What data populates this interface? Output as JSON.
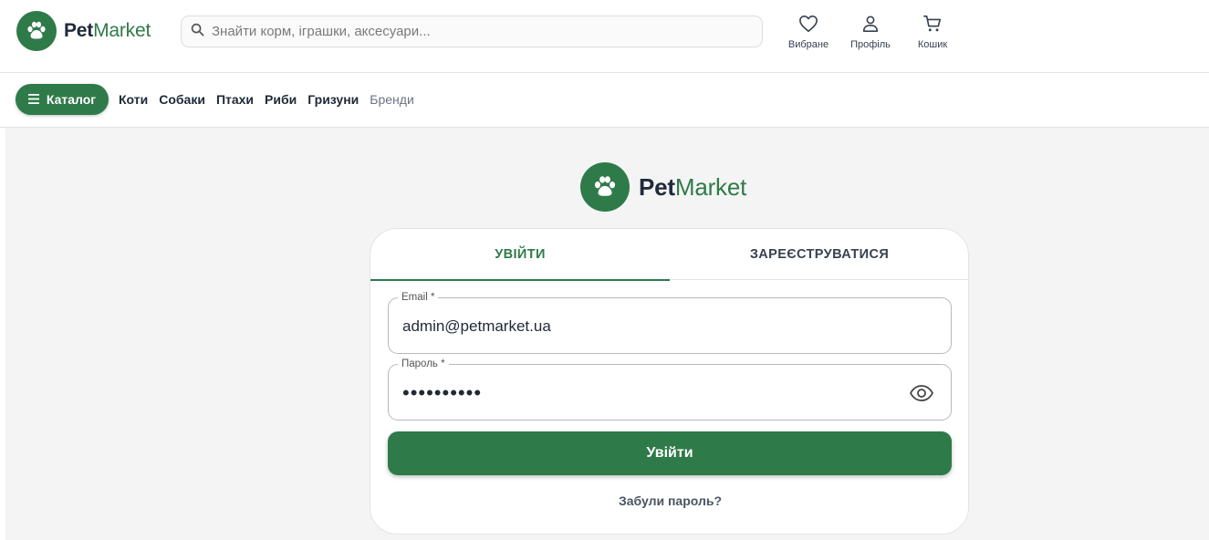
{
  "colors": {
    "brand": "#2f7a49",
    "brand_dark": "#1f2a3a",
    "accent_text": "#2f7a49"
  },
  "brand": {
    "part1": "Pet",
    "part2": "Market"
  },
  "search": {
    "placeholder": "Знайти корм, іграшки, аксесуари..."
  },
  "header_actions": [
    {
      "icon": "heart-icon",
      "label": "Вибране"
    },
    {
      "icon": "user-icon",
      "label": "Профіль"
    },
    {
      "icon": "cart-icon",
      "label": "Кошик"
    }
  ],
  "nav": {
    "catalog_label": "Каталог",
    "links": [
      "Коти",
      "Собаки",
      "Птахи",
      "Риби",
      "Гризуни",
      "Бренди"
    ]
  },
  "auth": {
    "tabs": {
      "login": "УВІЙТИ",
      "register": "ЗАРЕЄСТРУВАТИСЯ",
      "active": "login"
    },
    "email": {
      "label": "Email *",
      "value": "admin@petmarket.ua"
    },
    "password": {
      "label": "Пароль *",
      "value": "••••••••••"
    },
    "submit_label": "Увійти",
    "forgot_label": "Забули пароль?"
  }
}
